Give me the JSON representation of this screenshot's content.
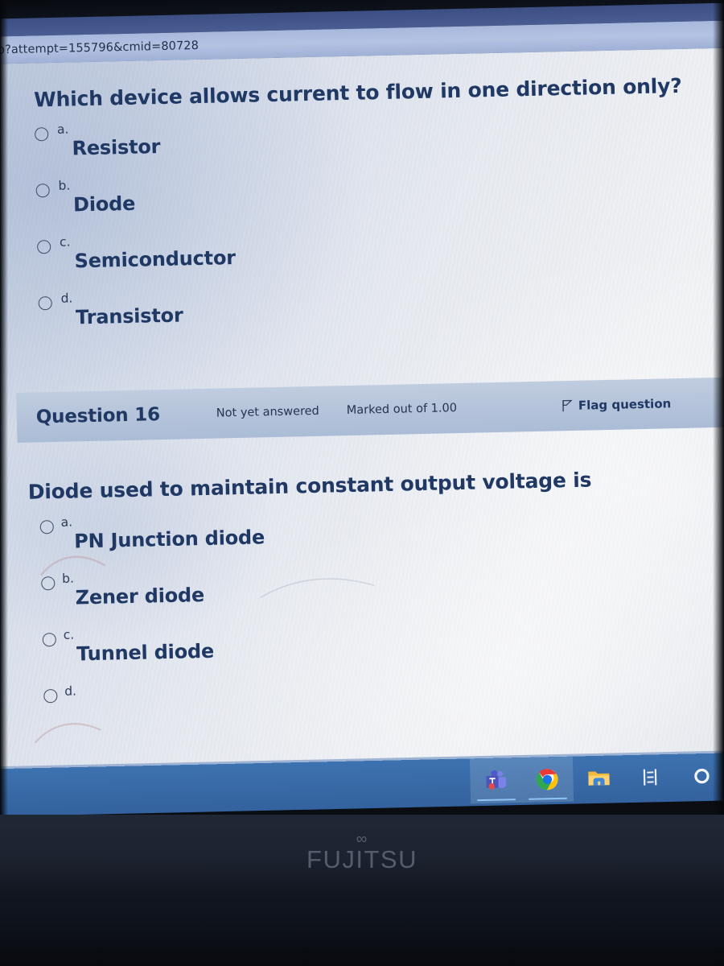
{
  "browser": {
    "url": "p?attempt=155796&cmid=80728"
  },
  "quiz": {
    "question_top": {
      "text": "Which device  allows current to flow in one direction only?",
      "options": [
        {
          "letter": "a.",
          "label": "Resistor"
        },
        {
          "letter": "b.",
          "label": "Diode"
        },
        {
          "letter": "c.",
          "label": "Semiconductor"
        },
        {
          "letter": "d.",
          "label": "Transistor"
        }
      ]
    },
    "question_16": {
      "header": {
        "title": "Question 16",
        "state": "Not yet answered",
        "marks": "Marked out of 1.00",
        "flag_label": "Flag question",
        "flag_icon": "flag-icon",
        "bar_color": "#b4c3da"
      },
      "text": "Diode used to maintain constant output voltage is",
      "options": [
        {
          "letter": "a.",
          "label": "PN Junction diode"
        },
        {
          "letter": "b.",
          "label": "Zener diode"
        },
        {
          "letter": "c.",
          "label": "Tunnel diode"
        },
        {
          "letter": "d.",
          "label": ""
        }
      ]
    }
  },
  "taskbar": {
    "background_color": "#3d72b0",
    "items": [
      {
        "name": "teams-icon",
        "label": "Microsoft Teams"
      },
      {
        "name": "chrome-icon",
        "label": "Google Chrome"
      },
      {
        "name": "file-explorer-icon",
        "label": "File Explorer"
      },
      {
        "name": "media-app-icon",
        "label": "Media"
      },
      {
        "name": "cortana-icon",
        "label": "Cortana"
      }
    ]
  },
  "laptop": {
    "brand_mark": "∞",
    "brand": "FUJITSU"
  },
  "theme": {
    "text_color": "#1f3864",
    "page_bg": "#e7eaf0"
  }
}
